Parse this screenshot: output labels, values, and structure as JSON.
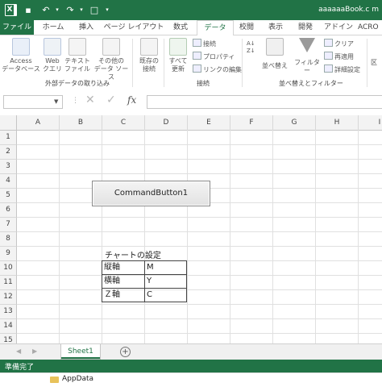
{
  "window": {
    "title": "aaaaaaBook.c m",
    "accent_color": "#217346"
  },
  "tabs": [
    "ファイル",
    "ホーム",
    "挿入",
    "ページ レイアウト",
    "数式",
    "データ",
    "校閲",
    "表示",
    "開発",
    "アドイン",
    "ACRO"
  ],
  "active_tab": "データ",
  "ribbon": {
    "external_data": {
      "group_label": "外部データの取り込み",
      "buttons": [
        {
          "l1": "Access",
          "l2": "データベース"
        },
        {
          "l1": "Web",
          "l2": "クエリ"
        },
        {
          "l1": "テキスト",
          "l2": "ファイル"
        },
        {
          "l1": "その他の",
          "l2": "データ ソース"
        }
      ],
      "existing_conn": {
        "l1": "既存の",
        "l2": "接続"
      }
    },
    "connections": {
      "group_label": "接続",
      "refresh_all": {
        "l1": "すべて",
        "l2": "更新"
      },
      "items": [
        "接続",
        "プロパティ",
        "リンクの編集"
      ]
    },
    "sort_filter": {
      "group_label": "並べ替えとフィルター",
      "sort": "並べ替え",
      "filter": "フィルター",
      "items": [
        "クリア",
        "再適用",
        "詳細設定"
      ],
      "cut_off": "区"
    }
  },
  "formula_bar": {
    "name_box": "",
    "formula": "",
    "fx_label": "fx"
  },
  "grid": {
    "columns": [
      "A",
      "B",
      "C",
      "D",
      "E",
      "F",
      "G",
      "H",
      "I"
    ],
    "rows": [
      "1",
      "2",
      "3",
      "4",
      "5",
      "6",
      "7",
      "8",
      "9",
      "10",
      "11",
      "12",
      "13",
      "14",
      "15"
    ]
  },
  "content": {
    "command_button": "CommandButton1",
    "chart_settings_title": "チャートの設定",
    "settings": [
      {
        "key": "縦軸",
        "value": "M"
      },
      {
        "key": "横軸",
        "value": "Y"
      },
      {
        "key": "Ｚ軸",
        "value": "C"
      }
    ]
  },
  "sheets": [
    "Sheet1"
  ],
  "status": "準備完了",
  "explorer_item": "AppData"
}
